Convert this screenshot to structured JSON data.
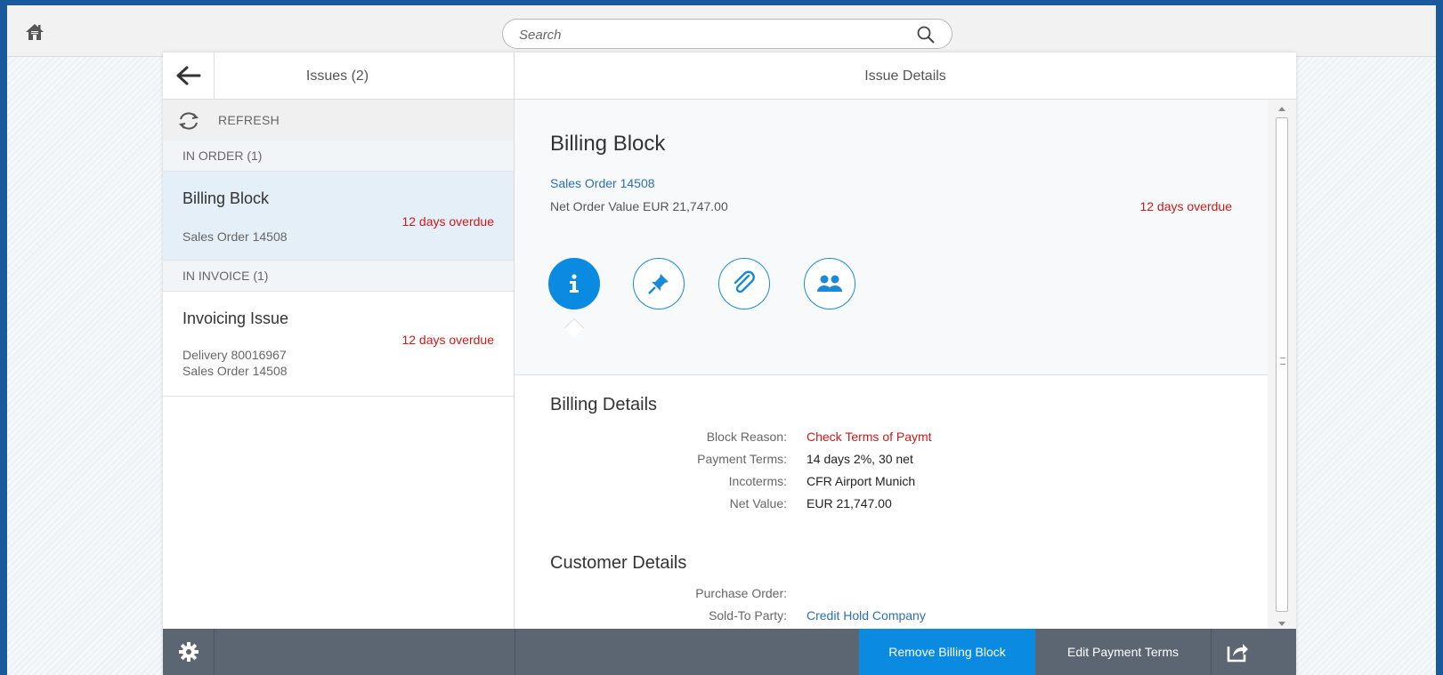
{
  "shell": {
    "search_placeholder": "Search"
  },
  "master": {
    "title": "Issues (2)",
    "refresh_label": "REFRESH",
    "groups": [
      {
        "header": "IN ORDER (1)",
        "items": [
          {
            "title": "Billing Block",
            "lines": [
              "Sales Order 14508"
            ],
            "status": "12 days overdue",
            "selected": true
          }
        ]
      },
      {
        "header": "IN INVOICE (1)",
        "items": [
          {
            "title": "Invoicing Issue",
            "lines": [
              "Delivery 80016967",
              "Sales Order 14508"
            ],
            "status": "12 days overdue",
            "selected": false
          }
        ]
      }
    ]
  },
  "detail": {
    "header_title": "Issue Details",
    "object": {
      "title": "Billing Block",
      "link": "Sales Order 14508",
      "attribute": "Net Order Value EUR 21,747.00",
      "status": "12 days overdue"
    },
    "tabs": [
      {
        "icon": "info-icon",
        "active": true
      },
      {
        "icon": "pin-icon",
        "active": false
      },
      {
        "icon": "attachment-icon",
        "active": false
      },
      {
        "icon": "people-icon",
        "active": false
      }
    ],
    "billing_details": {
      "title": "Billing Details",
      "rows": [
        {
          "label": "Block Reason:",
          "value": "Check Terms of Paymt",
          "style": "red"
        },
        {
          "label": "Payment Terms:",
          "value": "14 days 2%, 30 net",
          "style": ""
        },
        {
          "label": "Incoterms:",
          "value": "CFR Airport Munich",
          "style": ""
        },
        {
          "label": "Net Value:",
          "value": "EUR 21,747.00",
          "style": ""
        }
      ]
    },
    "customer_details": {
      "title": "Customer Details",
      "rows": [
        {
          "label": "Purchase Order:",
          "value": "",
          "style": ""
        },
        {
          "label": "Sold-To Party:",
          "value": "Credit Hold Company",
          "style": "link"
        }
      ]
    }
  },
  "footer": {
    "primary_label": "Remove Billing Block",
    "secondary_label": "Edit Payment Terms"
  },
  "colors": {
    "accent": "#0a8ae0",
    "overdue": "#cc1919",
    "link": "#2b6fb6",
    "footer_bg": "#5b6672"
  }
}
